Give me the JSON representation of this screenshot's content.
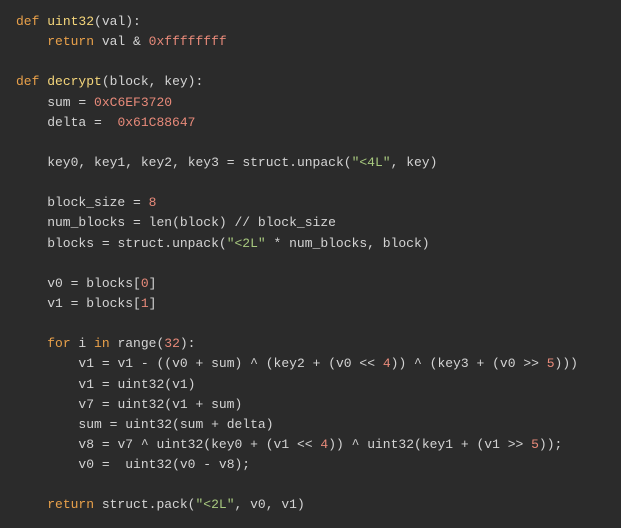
{
  "tokens": [
    [
      [
        "kw",
        "def"
      ],
      [
        "id",
        " "
      ],
      [
        "fn",
        "uint32"
      ],
      [
        "op",
        "("
      ],
      [
        "id",
        "val"
      ],
      [
        "op",
        "):"
      ]
    ],
    [
      [
        "id",
        "    "
      ],
      [
        "kw",
        "return"
      ],
      [
        "id",
        " val "
      ],
      [
        "op",
        "&"
      ],
      [
        "id",
        " "
      ],
      [
        "num",
        "0xffffffff"
      ]
    ],
    [],
    [
      [
        "kw",
        "def"
      ],
      [
        "id",
        " "
      ],
      [
        "fn",
        "decrypt"
      ],
      [
        "op",
        "("
      ],
      [
        "id",
        "block"
      ],
      [
        "op",
        ", "
      ],
      [
        "id",
        "key"
      ],
      [
        "op",
        "):"
      ]
    ],
    [
      [
        "id",
        "    sum "
      ],
      [
        "op",
        "="
      ],
      [
        "id",
        " "
      ],
      [
        "num",
        "0xC6EF3720"
      ]
    ],
    [
      [
        "id",
        "    delta "
      ],
      [
        "op",
        "="
      ],
      [
        "id",
        "  "
      ],
      [
        "num",
        "0x61C88647"
      ]
    ],
    [],
    [
      [
        "id",
        "    key0"
      ],
      [
        "op",
        ", "
      ],
      [
        "id",
        "key1"
      ],
      [
        "op",
        ", "
      ],
      [
        "id",
        "key2"
      ],
      [
        "op",
        ", "
      ],
      [
        "id",
        "key3 "
      ],
      [
        "op",
        "="
      ],
      [
        "id",
        " struct"
      ],
      [
        "op",
        "."
      ],
      [
        "id",
        "unpack"
      ],
      [
        "op",
        "("
      ],
      [
        "str",
        "\"<4L\""
      ],
      [
        "op",
        ", "
      ],
      [
        "id",
        "key"
      ],
      [
        "op",
        ")"
      ]
    ],
    [],
    [
      [
        "id",
        "    block_size "
      ],
      [
        "op",
        "="
      ],
      [
        "id",
        " "
      ],
      [
        "num",
        "8"
      ]
    ],
    [
      [
        "id",
        "    num_blocks "
      ],
      [
        "op",
        "="
      ],
      [
        "id",
        " len"
      ],
      [
        "op",
        "("
      ],
      [
        "id",
        "block"
      ],
      [
        "op",
        ") // "
      ],
      [
        "id",
        "block_size"
      ]
    ],
    [
      [
        "id",
        "    blocks "
      ],
      [
        "op",
        "="
      ],
      [
        "id",
        " struct"
      ],
      [
        "op",
        "."
      ],
      [
        "id",
        "unpack"
      ],
      [
        "op",
        "("
      ],
      [
        "str",
        "\"<2L\""
      ],
      [
        "id",
        " "
      ],
      [
        "op",
        "*"
      ],
      [
        "id",
        " num_blocks"
      ],
      [
        "op",
        ", "
      ],
      [
        "id",
        "block"
      ],
      [
        "op",
        ")"
      ]
    ],
    [],
    [
      [
        "id",
        "    v0 "
      ],
      [
        "op",
        "="
      ],
      [
        "id",
        " blocks"
      ],
      [
        "op",
        "["
      ],
      [
        "num",
        "0"
      ],
      [
        "op",
        "]"
      ]
    ],
    [
      [
        "id",
        "    v1 "
      ],
      [
        "op",
        "="
      ],
      [
        "id",
        " blocks"
      ],
      [
        "op",
        "["
      ],
      [
        "num",
        "1"
      ],
      [
        "op",
        "]"
      ]
    ],
    [],
    [
      [
        "id",
        "    "
      ],
      [
        "kw",
        "for"
      ],
      [
        "id",
        " i "
      ],
      [
        "kw",
        "in"
      ],
      [
        "id",
        " range"
      ],
      [
        "op",
        "("
      ],
      [
        "num",
        "32"
      ],
      [
        "op",
        "):"
      ]
    ],
    [
      [
        "id",
        "        v1 "
      ],
      [
        "op",
        "="
      ],
      [
        "id",
        " v1 "
      ],
      [
        "op",
        "-"
      ],
      [
        "id",
        " "
      ],
      [
        "op",
        "(("
      ],
      [
        "id",
        "v0 "
      ],
      [
        "op",
        "+"
      ],
      [
        "id",
        " sum"
      ],
      [
        "op",
        ") ^ ("
      ],
      [
        "id",
        "key2 "
      ],
      [
        "op",
        "+"
      ],
      [
        "id",
        " "
      ],
      [
        "op",
        "("
      ],
      [
        "id",
        "v0 "
      ],
      [
        "op",
        "<<"
      ],
      [
        "id",
        " "
      ],
      [
        "num",
        "4"
      ],
      [
        "op",
        ")) ^ ("
      ],
      [
        "id",
        "key3 "
      ],
      [
        "op",
        "+"
      ],
      [
        "id",
        " "
      ],
      [
        "op",
        "("
      ],
      [
        "id",
        "v0 "
      ],
      [
        "op",
        ">>"
      ],
      [
        "id",
        " "
      ],
      [
        "num",
        "5"
      ],
      [
        "op",
        ")))"
      ]
    ],
    [
      [
        "id",
        "        v1 "
      ],
      [
        "op",
        "="
      ],
      [
        "id",
        " uint32"
      ],
      [
        "op",
        "("
      ],
      [
        "id",
        "v1"
      ],
      [
        "op",
        ")"
      ]
    ],
    [
      [
        "id",
        "        v7 "
      ],
      [
        "op",
        "="
      ],
      [
        "id",
        " uint32"
      ],
      [
        "op",
        "("
      ],
      [
        "id",
        "v1 "
      ],
      [
        "op",
        "+"
      ],
      [
        "id",
        " sum"
      ],
      [
        "op",
        ")"
      ]
    ],
    [
      [
        "id",
        "        sum "
      ],
      [
        "op",
        "="
      ],
      [
        "id",
        " uint32"
      ],
      [
        "op",
        "("
      ],
      [
        "id",
        "sum "
      ],
      [
        "op",
        "+"
      ],
      [
        "id",
        " delta"
      ],
      [
        "op",
        ")"
      ]
    ],
    [
      [
        "id",
        "        v8 "
      ],
      [
        "op",
        "="
      ],
      [
        "id",
        " v7 "
      ],
      [
        "op",
        "^"
      ],
      [
        "id",
        " uint32"
      ],
      [
        "op",
        "("
      ],
      [
        "id",
        "key0 "
      ],
      [
        "op",
        "+"
      ],
      [
        "id",
        " "
      ],
      [
        "op",
        "("
      ],
      [
        "id",
        "v1 "
      ],
      [
        "op",
        "<<"
      ],
      [
        "id",
        " "
      ],
      [
        "num",
        "4"
      ],
      [
        "op",
        ")) ^ "
      ],
      [
        "id",
        "uint32"
      ],
      [
        "op",
        "("
      ],
      [
        "id",
        "key1 "
      ],
      [
        "op",
        "+"
      ],
      [
        "id",
        " "
      ],
      [
        "op",
        "("
      ],
      [
        "id",
        "v1 "
      ],
      [
        "op",
        ">>"
      ],
      [
        "id",
        " "
      ],
      [
        "num",
        "5"
      ],
      [
        "op",
        "));"
      ]
    ],
    [
      [
        "id",
        "        v0 "
      ],
      [
        "op",
        "="
      ],
      [
        "id",
        "  uint32"
      ],
      [
        "op",
        "("
      ],
      [
        "id",
        "v0 "
      ],
      [
        "op",
        "-"
      ],
      [
        "id",
        " v8"
      ],
      [
        "op",
        ");"
      ]
    ],
    [],
    [
      [
        "id",
        "    "
      ],
      [
        "kw",
        "return"
      ],
      [
        "id",
        " struct"
      ],
      [
        "op",
        "."
      ],
      [
        "id",
        "pack"
      ],
      [
        "op",
        "("
      ],
      [
        "str",
        "\"<2L\""
      ],
      [
        "op",
        ", "
      ],
      [
        "id",
        "v0"
      ],
      [
        "op",
        ", "
      ],
      [
        "id",
        "v1"
      ],
      [
        "op",
        ")"
      ]
    ]
  ]
}
